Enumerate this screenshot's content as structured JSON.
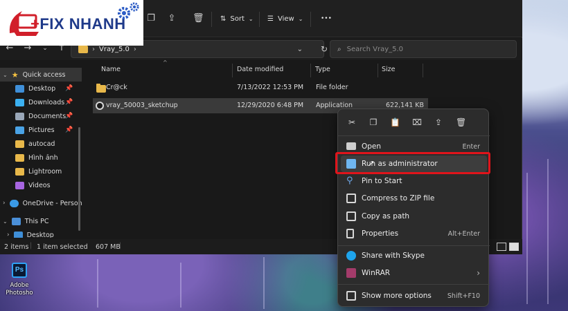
{
  "logo": {
    "plus": "+",
    "text": "FIX NHANH"
  },
  "toolbar": {
    "sort_label": "Sort",
    "view_label": "View",
    "more_label": "•••"
  },
  "address": {
    "folder": "Vray_5.0",
    "separator": "›"
  },
  "search": {
    "placeholder": "Search Vray_5.0"
  },
  "sidebar": {
    "items": [
      {
        "label": "Quick access",
        "color": "#f5c242"
      },
      {
        "label": "Desktop",
        "color": "#3f8fd8"
      },
      {
        "label": "Downloads",
        "color": "#3bb0f0"
      },
      {
        "label": "Documents",
        "color": "#9aa7b8"
      },
      {
        "label": "Pictures",
        "color": "#4aa3e6"
      },
      {
        "label": "autocad",
        "color": "#e8b84a"
      },
      {
        "label": "Hình ảnh",
        "color": "#e8b84a"
      },
      {
        "label": "Lightroom",
        "color": "#e8b84a"
      },
      {
        "label": "Videos",
        "color": "#a765e0"
      },
      {
        "label": "OneDrive - Person",
        "color": "#3a9ae6"
      },
      {
        "label": "This PC",
        "color": "#4a8fd8"
      },
      {
        "label": "Desktop",
        "color": "#3f8fd8"
      }
    ]
  },
  "columns": {
    "name": "Name",
    "date": "Date modified",
    "type": "Type",
    "size": "Size"
  },
  "files": [
    {
      "name": "Cr@ck",
      "date": "7/13/2022 12:53 PM",
      "type": "File folder",
      "size": ""
    },
    {
      "name": "vray_50003_sketchup",
      "date": "12/29/2020 6:48 PM",
      "type": "Application",
      "size": "622,141 KB"
    }
  ],
  "status": {
    "items": "2 items",
    "selected": "1 item selected",
    "size": "607 MB"
  },
  "context_menu": {
    "items": [
      {
        "label": "Open",
        "shortcut": "Enter",
        "color": "#cfcfcf"
      },
      {
        "label": "Run as administrator",
        "shortcut": "",
        "color": "#6fb6f0"
      },
      {
        "label": "Pin to Start",
        "shortcut": "",
        "color": "#6fa8e8"
      },
      {
        "label": "Compress to ZIP file",
        "shortcut": "",
        "color": "#d8d8d8"
      },
      {
        "label": "Copy as path",
        "shortcut": "",
        "color": "#d8d8d8"
      },
      {
        "label": "Properties",
        "shortcut": "Alt+Enter",
        "color": "#d8d8d8"
      },
      {
        "label": "Share with Skype",
        "shortcut": "",
        "color": "#1ea4ec"
      },
      {
        "label": "WinRAR",
        "shortcut": "›",
        "color": "#a33b6a"
      },
      {
        "label": "Show more options",
        "shortcut": "Shift+F10",
        "color": "#d8d8d8"
      }
    ]
  },
  "desktop": {
    "app_label": "Adobe Photosho",
    "app_abbr": "Ps"
  }
}
